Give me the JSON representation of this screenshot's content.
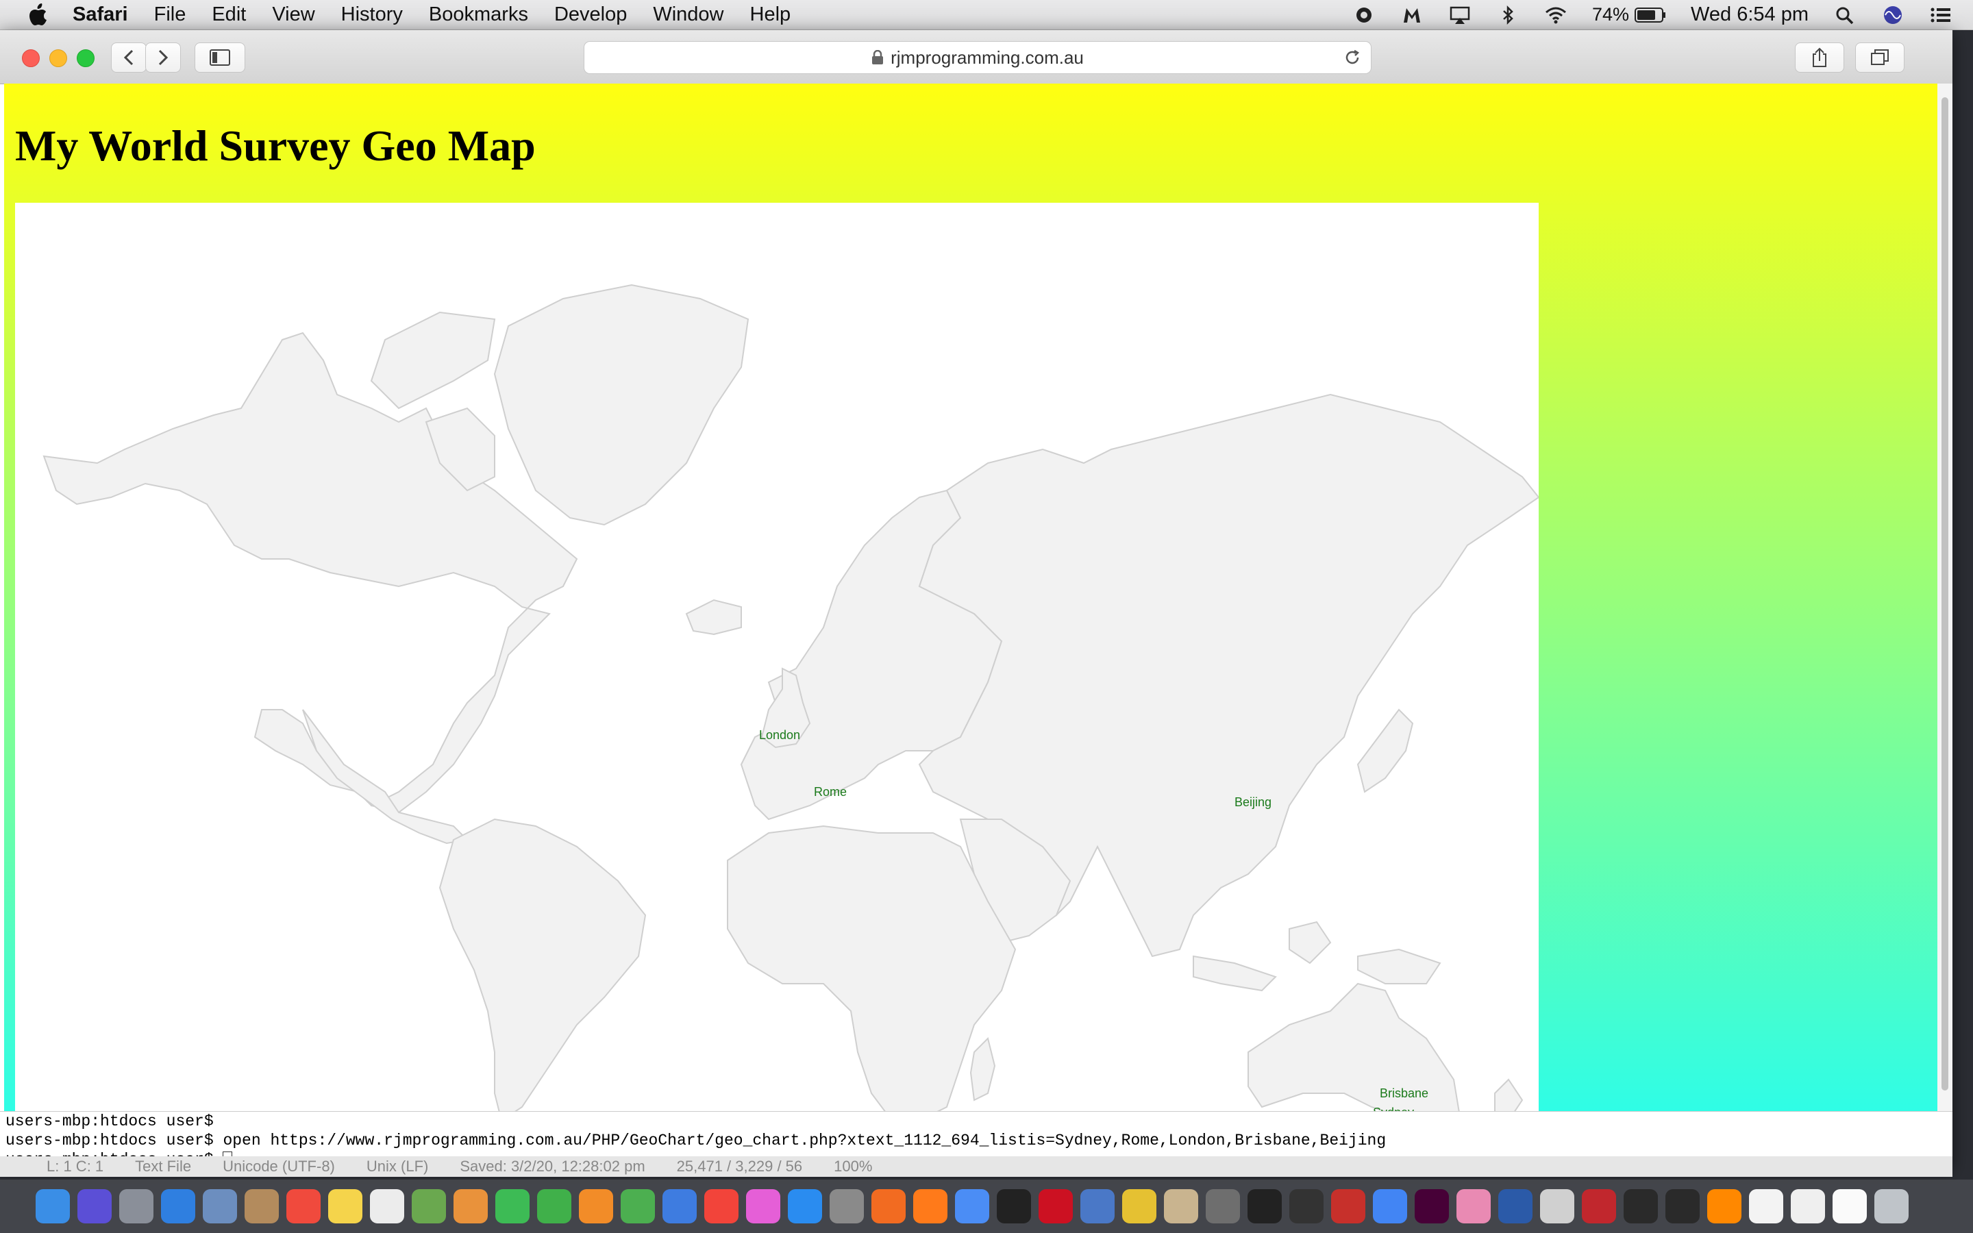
{
  "menubar": {
    "app_name": "Safari",
    "items": [
      "File",
      "Edit",
      "View",
      "History",
      "Bookmarks",
      "Develop",
      "Window",
      "Help"
    ],
    "battery": "74%",
    "clock": "Wed 6:54 pm"
  },
  "browser": {
    "url": "rjmprogramming.com.au"
  },
  "page": {
    "title": "My World Survey Geo Map"
  },
  "map": {
    "markers": [
      {
        "label": "London"
      },
      {
        "label": "Rome"
      },
      {
        "label": "Beijing"
      },
      {
        "label": "Brisbane"
      },
      {
        "label": "Sydney"
      }
    ]
  },
  "terminal": {
    "lines": [
      "users-mbp:htdocs user$",
      "users-mbp:htdocs user$ open https://www.rjmprogramming.com.au/PHP/GeoChart/geo_chart.php?xtext_1112_694_listis=Sydney,Rome,London,Brisbane,Beijing",
      "users-mbp:htdocs user$ "
    ],
    "editor_status": [
      "L: 1 C: 1",
      "Text File",
      "Unicode (UTF-8)",
      "Unix (LF)",
      "Saved: 3/2/20, 12:28:02 pm",
      "25,471 / 3,229 / 56",
      "100%"
    ]
  },
  "colors": {
    "page_gradient_top": "#ffff10",
    "page_gradient_bottom": "#2ffde6",
    "land": "#f2f2f2",
    "border": "#cfcfcf",
    "label": "#1b7a1b"
  },
  "dock_icons": [
    "finder-icon",
    "siri-icon",
    "launchpad-icon",
    "safari-icon",
    "mail-icon",
    "contacts-icon",
    "calendar-icon",
    "notes-icon",
    "reminders-icon",
    "maps-icon",
    "photos-icon",
    "messages-icon",
    "facetime-icon",
    "pages-icon",
    "numbers-icon",
    "keynote-icon",
    "news-icon",
    "itunes-icon",
    "app-store-icon",
    "system-preferences-icon",
    "avast-icon",
    "firefox-icon",
    "chrome-icon",
    "phpstorm-icon",
    "opera-icon",
    "sequel-pro-icon",
    "aquamacs-icon",
    "preview-icon",
    "automator-icon",
    "terminal-icon",
    "inkscape-icon",
    "photo-booth-icon",
    "folder-icon",
    "xd-icon",
    "colorsync-icon",
    "filemerge-icon",
    "mail-2-icon",
    "filezilla-icon",
    "console-icon",
    "console-2-icon",
    "x11-icon",
    "documents-icon",
    "downloads-icon",
    "desktop-icon",
    "trash-icon"
  ]
}
